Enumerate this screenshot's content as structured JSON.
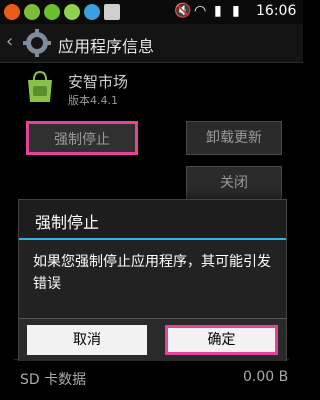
{
  "status_bar": {
    "left_icons": [
      "notification-icon",
      "app-icon",
      "chat-icon",
      "wechat-icon",
      "browser-icon",
      "image-icon"
    ],
    "right_icons": [
      "mute-icon",
      "wifi-icon",
      "signal-icon",
      "battery-icon"
    ],
    "time": "16:06"
  },
  "header": {
    "title": "应用程序信息"
  },
  "app": {
    "name": "安智市场",
    "version": "版本4.4.1"
  },
  "buttons": {
    "force_stop": "强制停止",
    "uninstall_updates": "卸载更新",
    "close": "关闭"
  },
  "dialog": {
    "title": "强制停止",
    "message": "如果您强制停止应用程序，其可能引发错误",
    "cancel": "取消",
    "confirm": "确定"
  },
  "storage": {
    "sd_label": "SD 卡数据",
    "sd_value": "0.00 B"
  },
  "colors": {
    "highlight": "#e3439b",
    "accent": "#33b5e5",
    "background": "#000000"
  }
}
